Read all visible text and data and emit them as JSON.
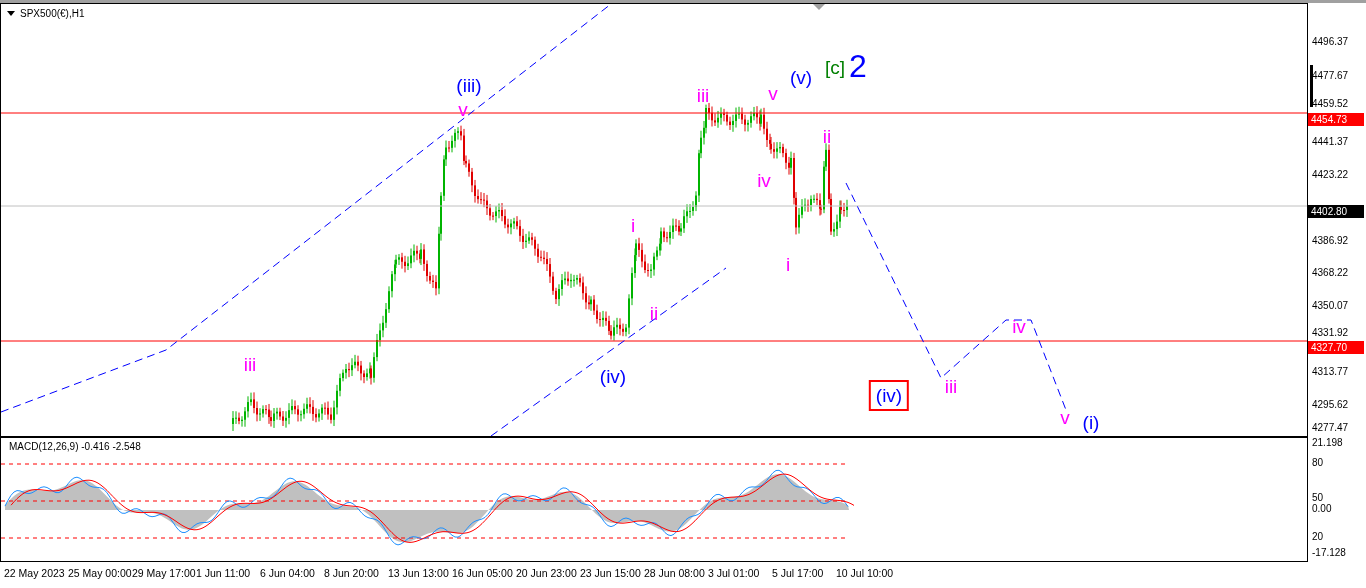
{
  "chart_title": "SPX500(€),H1",
  "wave_labels": [
    {
      "text": "(iii)",
      "color": "#0000ff",
      "kind": "wave"
    },
    {
      "text": "v",
      "color": "#ff00ff",
      "kind": "wave"
    },
    {
      "text": "iii",
      "color": "#ff00ff",
      "kind": "wave"
    },
    {
      "text": "(iv)",
      "color": "#0000ff",
      "kind": "wave"
    },
    {
      "text": "i",
      "color": "#ff00ff",
      "kind": "wave"
    },
    {
      "text": "ii",
      "color": "#ff00ff",
      "kind": "wave"
    },
    {
      "text": "iii",
      "color": "#ff00ff",
      "kind": "wave"
    },
    {
      "text": "v",
      "color": "#ff00ff",
      "kind": "wave"
    },
    {
      "text": "(v)",
      "color": "#0000ff",
      "kind": "wave"
    },
    {
      "text": "[c]",
      "color": "#008000",
      "kind": "wave"
    },
    {
      "text": "2",
      "color": "#0000ff",
      "kind": "major"
    },
    {
      "text": "iv",
      "color": "#ff00ff",
      "kind": "wave"
    },
    {
      "text": "ii",
      "color": "#ff00ff",
      "kind": "wave"
    },
    {
      "text": "i",
      "color": "#ff00ff",
      "kind": "wave"
    },
    {
      "text": "(iv)",
      "color": "#0000ff",
      "kind": "boxed"
    },
    {
      "text": "iii",
      "color": "#ff00ff",
      "kind": "wave"
    },
    {
      "text": "iv",
      "color": "#ff00ff",
      "kind": "wave"
    },
    {
      "text": "v",
      "color": "#ff00ff",
      "kind": "wave"
    },
    {
      "text": "(i)",
      "color": "#0000ff",
      "kind": "wave"
    }
  ],
  "price_axis": [
    "4496.37",
    "4477.67",
    "4459.52",
    "4441.37",
    "4423.22",
    "4386.92",
    "4368.22",
    "4350.07",
    "4331.92",
    "4313.77",
    "4295.62",
    "4277.47"
  ],
  "price_markers": [
    {
      "text": "4454.73",
      "kind": "level"
    },
    {
      "text": "4402.80",
      "kind": "current"
    },
    {
      "text": "4327.70",
      "kind": "level"
    }
  ],
  "macd": {
    "title": "MACD(12,26,9) -0.416 -2.548",
    "axis": [
      "21.198",
      "80",
      "50",
      "0.00",
      "20",
      "-17.128"
    ]
  },
  "time_axis": [
    "22 May 2023",
    "25 May 00:00",
    "29 May 17:00",
    "1 Jun 11:00",
    "6 Jun 04:00",
    "8 Jun 20:00",
    "13 Jun 13:00",
    "16 Jun 05:00",
    "20 Jun 23:00",
    "23 Jun 15:00",
    "28 Jun 08:00",
    "3 Jul 01:00",
    "5 Jul 17:00",
    "10 Jul 10:00"
  ]
}
